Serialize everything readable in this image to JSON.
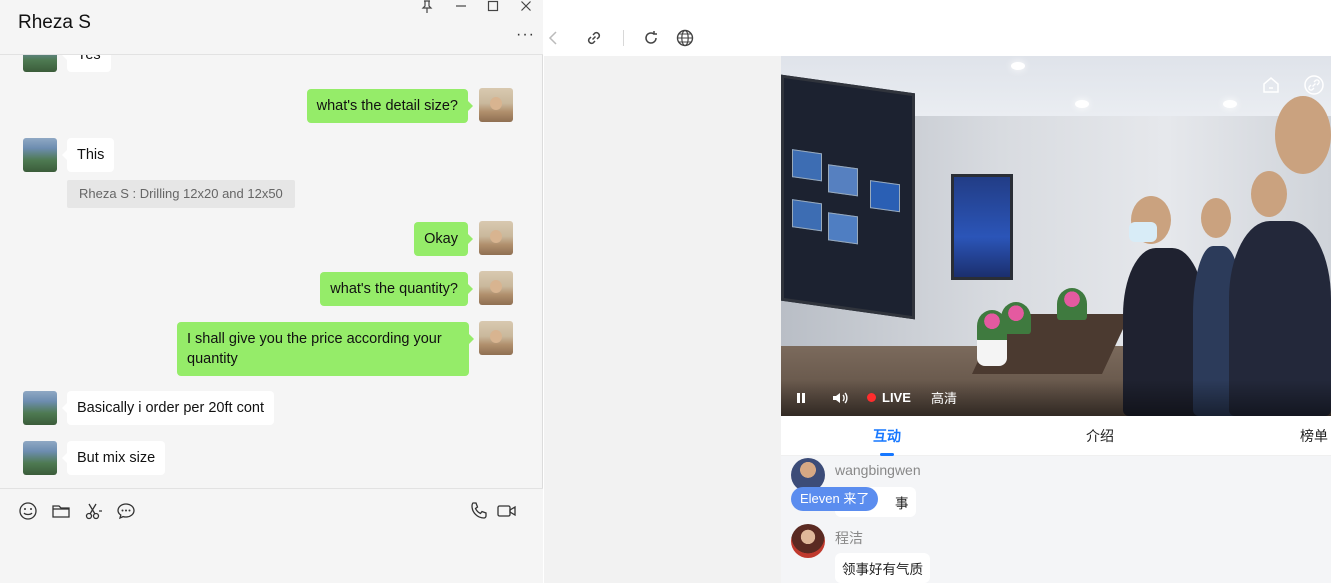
{
  "chat": {
    "title": "Rheza S",
    "window_controls": [
      "pin-icon",
      "minimize-icon",
      "maximize-icon",
      "close-icon"
    ],
    "more_label": "···",
    "messages": [
      {
        "from": "them",
        "text": "Yes"
      },
      {
        "from": "me",
        "text": "what's the detail size?"
      },
      {
        "from": "them",
        "text": "This"
      },
      {
        "from": "quote",
        "text": "Rheza S : Drilling 12x20 and 12x50"
      },
      {
        "from": "me",
        "text": "Okay"
      },
      {
        "from": "me",
        "text": "what's the quantity?"
      },
      {
        "from": "me",
        "text": "I shall give you the price according your quantity"
      },
      {
        "from": "them",
        "text": "Basically i order per 20ft cont"
      },
      {
        "from": "them",
        "text": "But mix size"
      }
    ],
    "toolbar": [
      "emoji-icon",
      "folder-icon",
      "scissors-icon",
      "chat-history-icon",
      "phone-icon",
      "video-call-icon"
    ]
  },
  "browser": {
    "nav": [
      "back-icon",
      "link-icon",
      "refresh-icon",
      "globe-icon"
    ]
  },
  "live": {
    "live_label": "LIVE",
    "quality_label": "高清",
    "top_icons": [
      "home-icon",
      "share-link-icon"
    ]
  },
  "tabs": [
    {
      "label": "互动",
      "active": true
    },
    {
      "label": "介绍",
      "active": false
    },
    {
      "label": "榜单",
      "active": false
    }
  ],
  "comments": [
    {
      "user": "wangbingwen",
      "text": "事"
    },
    {
      "user": "程洁",
      "text": "领事好有气质"
    }
  ],
  "join_notice": "Eleven 来了",
  "colors": {
    "my_bubble": "#95ec69",
    "accent_blue": "#1677ff",
    "join_badge": "#5b8def",
    "live_red": "#ff2d2d"
  }
}
